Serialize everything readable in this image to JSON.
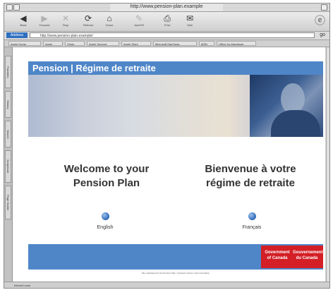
{
  "window": {
    "title": "http://www.pension-plan.example"
  },
  "toolbar": {
    "buttons": [
      {
        "icon": "back-arrow-icon",
        "label": "Back"
      },
      {
        "icon": "forward-arrow-icon",
        "label": "Forward"
      },
      {
        "icon": "stop-icon",
        "label": "Stop"
      },
      {
        "icon": "refresh-icon",
        "label": "Refresh"
      },
      {
        "icon": "home-icon",
        "label": "Home"
      },
      {
        "icon": "autofill-icon",
        "label": "AutoFill"
      },
      {
        "icon": "print-icon",
        "label": "Print"
      },
      {
        "icon": "mail-icon",
        "label": "Mail"
      }
    ]
  },
  "address": {
    "label": "Address",
    "value": "http://www.pension-plan.example/",
    "go": "go"
  },
  "favorites": [
    "Apple Home",
    "Apple",
    "iTools",
    "Apple Support",
    "Apple Store",
    "Microsoft MacTopia",
    "MSN",
    "Office for Macintosh"
  ],
  "side_tabs": [
    "Favorites",
    "History",
    "Search",
    "Scrapbook",
    "Page Holder"
  ],
  "page": {
    "banner": "Pension | Régime de retraite",
    "heading_en": "Welcome to your Pension Plan",
    "heading_fr": "Bienvenue à votre régime de retraite",
    "link_en": "English",
    "link_fr": "Français",
    "canada_en": "Government of Canada",
    "canada_fr": "Gouvernement du Canada",
    "footer": "Site maintained by the Pension Plan. Important notices / Avis importants."
  },
  "status": {
    "text": "Internet zone"
  },
  "colors": {
    "banner": "#4f86c8",
    "canada_red": "#d31f25",
    "window_frame": "#d4d4d4"
  }
}
